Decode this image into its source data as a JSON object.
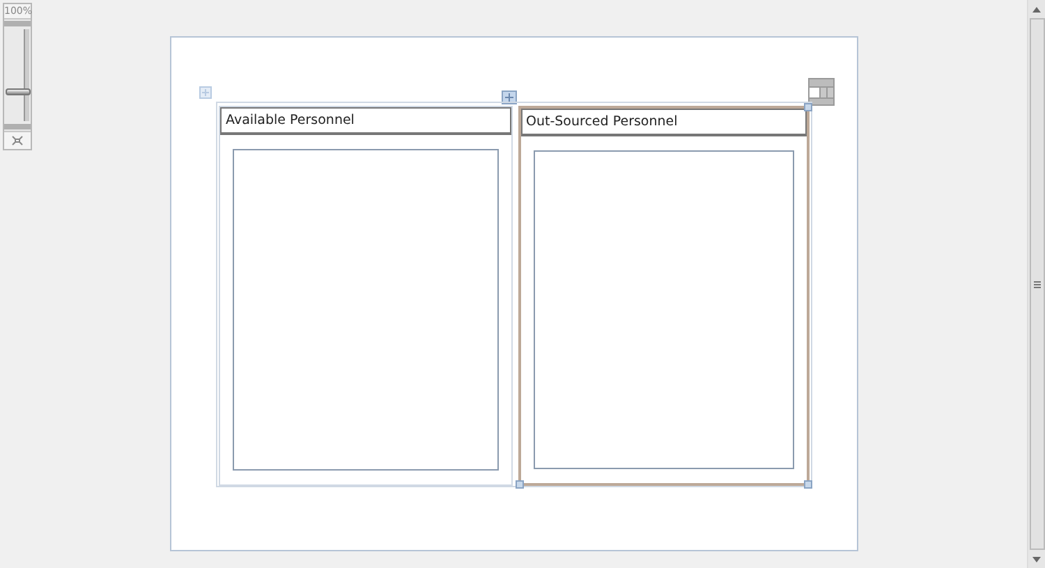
{
  "zoom": {
    "label": "100%",
    "level": 0.33
  },
  "panels": [
    {
      "header": "Available Personnel",
      "selected": false
    },
    {
      "header": "Out-Sourced Personnel",
      "selected": true
    }
  ]
}
